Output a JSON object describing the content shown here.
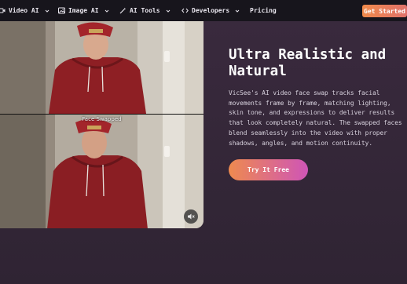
{
  "nav": {
    "items": [
      {
        "label": "Video AI",
        "icon": "video-icon",
        "has_dropdown": true
      },
      {
        "label": "Image AI",
        "icon": "image-icon",
        "has_dropdown": true
      },
      {
        "label": "AI Tools",
        "icon": "magic-wand-icon",
        "has_dropdown": true
      },
      {
        "label": "Developers",
        "icon": "code-icon",
        "has_dropdown": true
      },
      {
        "label": "Pricing",
        "icon": "",
        "has_dropdown": false
      }
    ],
    "cta_label": "Get Started"
  },
  "video": {
    "swap_label": "Face Swapped",
    "mute_icon": "speaker-muted-icon"
  },
  "hero": {
    "title": "Ultra Realistic and Natural",
    "description": "VicSee's AI video face swap tracks facial movements frame by frame, matching lighting, skin tone, and expressions to deliver results that look completely natural. The swapped faces blend seamlessly into the video with proper shadows, angles, and motion continuity.",
    "button_label": "Try It Free"
  },
  "colors": {
    "nav_bg": "#17151c",
    "page_bg": "#3a2a3e",
    "cta_gradient_start": "#f08a4b",
    "button_gradient_start": "#ee8a4f",
    "button_gradient_end": "#cf55b7",
    "hoodie": "#8e1f24"
  }
}
